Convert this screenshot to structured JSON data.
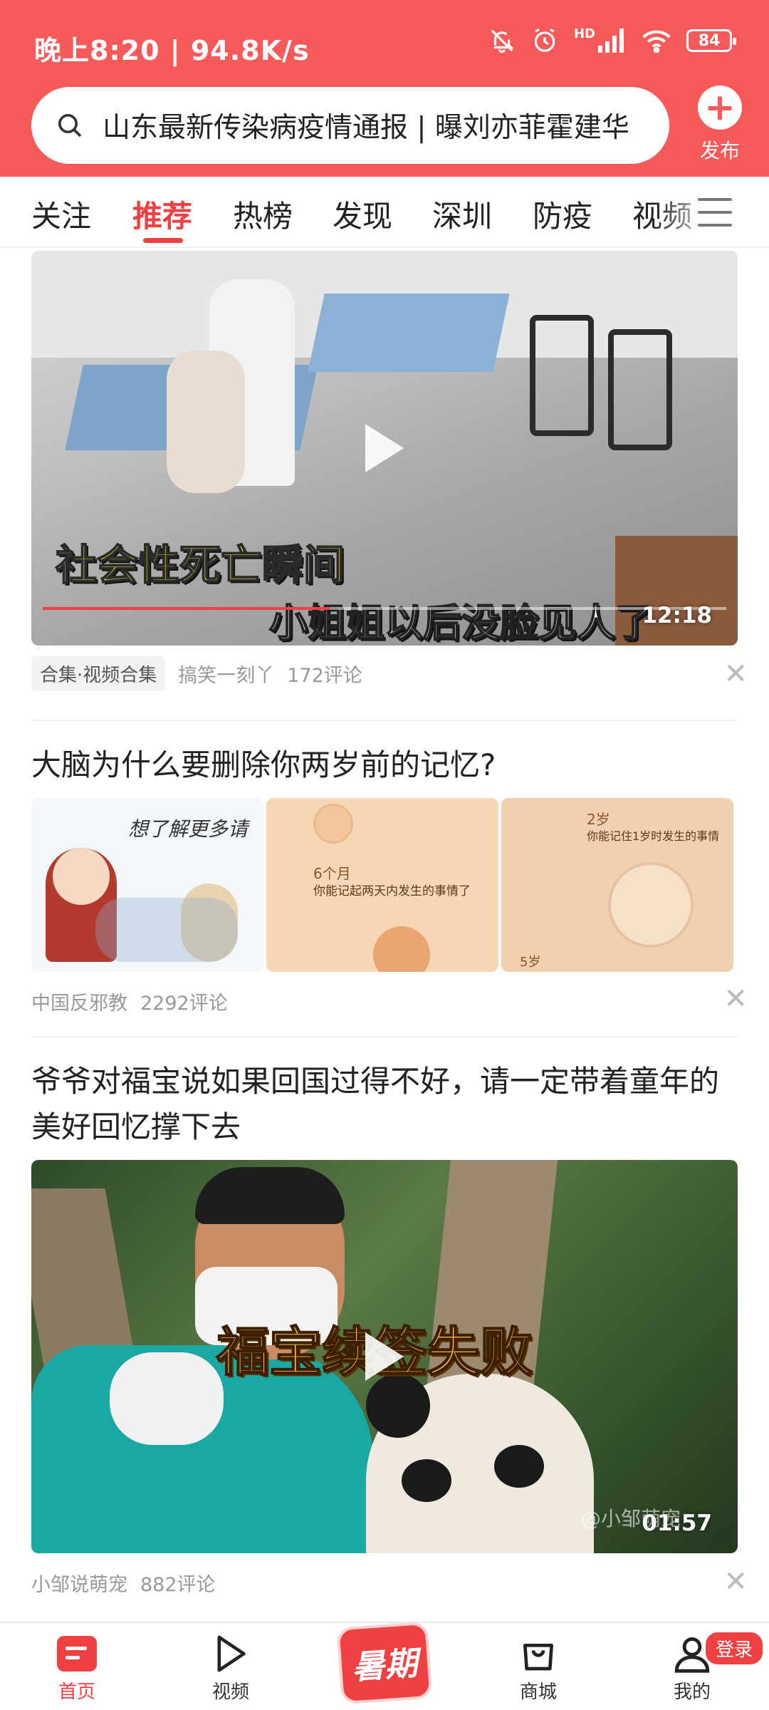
{
  "status": {
    "time": "晚上8:20 | 94.8K/s",
    "battery": "84",
    "network": "HD"
  },
  "search": {
    "value": "山东最新传染病疫情通报 | 曝刘亦菲霍建华"
  },
  "publish": {
    "label": "发布"
  },
  "tabs": [
    {
      "label": "关注"
    },
    {
      "label": "推荐",
      "active": true
    },
    {
      "label": "热榜"
    },
    {
      "label": "发现"
    },
    {
      "label": "深圳"
    },
    {
      "label": "防疫"
    },
    {
      "label": "视频"
    }
  ],
  "feed": [
    {
      "type": "video",
      "overlay_line1": "社会性死亡瞬间",
      "overlay_line2": "小姐姐以后没脸见人了",
      "duration": "12:18",
      "tag": "合集·视频合集",
      "source": "搞笑一刻丫",
      "comments": "172评论"
    },
    {
      "type": "images",
      "title": "大脑为什么要删除你两岁前的记忆?",
      "img1_text": "想了解更多请",
      "img2_label": "6个月",
      "img2_text": "你能记起两天内发生的事情了",
      "img3_label": "2岁",
      "img3_text": "你能记住1岁时发生的事情",
      "img3_corner": "5岁",
      "source": "中国反邪教",
      "comments": "2292评论"
    },
    {
      "type": "video",
      "title": "爷爷对福宝说如果回国过得不好，请一定带着童年的美好回忆撑下去",
      "overlay_line1": "福宝续签失败",
      "watermark": "@小邹萌宠",
      "duration": "01:57",
      "source": "小邹说萌宠",
      "comments": "882评论"
    }
  ],
  "bottom_nav": [
    {
      "label": "首页",
      "active": true
    },
    {
      "label": "视频"
    },
    {
      "label": "暑期"
    },
    {
      "label": "商城"
    },
    {
      "label": "我的"
    }
  ],
  "login_badge": "登录",
  "colors": {
    "brand": "#f85959",
    "accent": "#f04142"
  }
}
